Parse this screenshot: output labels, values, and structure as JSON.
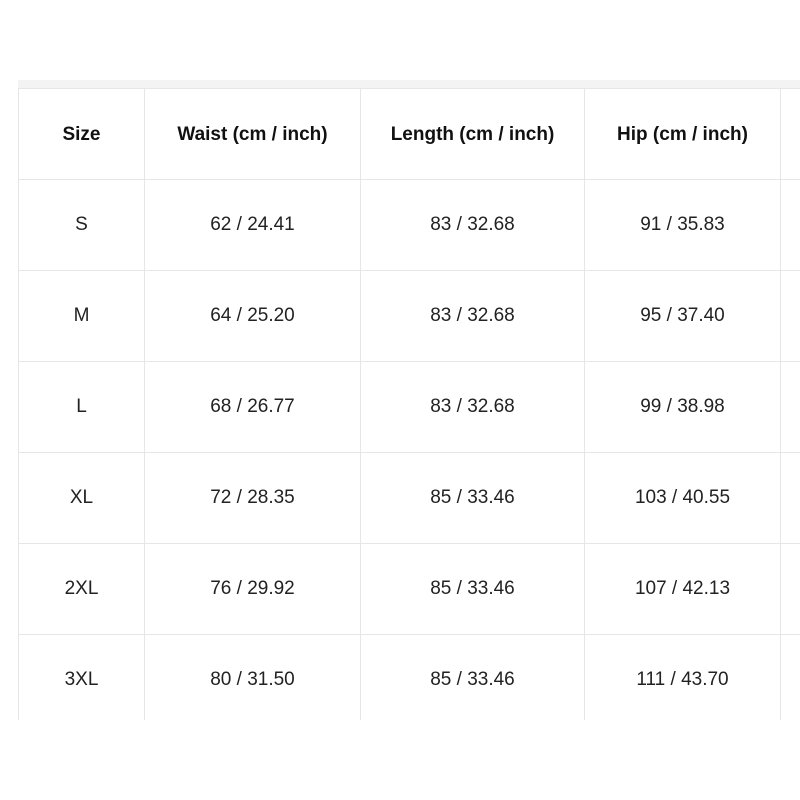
{
  "table": {
    "headers": [
      "Size",
      "Waist (cm / inch)",
      "Length (cm / inch)",
      "Hip (cm / inch)",
      ""
    ],
    "rows": [
      [
        "S",
        "62 / 24.41",
        "83 / 32.68",
        "91 / 35.83",
        ""
      ],
      [
        "M",
        "64 / 25.20",
        "83 / 32.68",
        "95 / 37.40",
        ""
      ],
      [
        "L",
        "68 / 26.77",
        "83 / 32.68",
        "99 / 38.98",
        ""
      ],
      [
        "XL",
        "72 / 28.35",
        "85 / 33.46",
        "103 / 40.55",
        ""
      ],
      [
        "2XL",
        "76 / 29.92",
        "85 / 33.46",
        "107 / 42.13",
        ""
      ],
      [
        "3XL",
        "80 / 31.50",
        "85 / 33.46",
        "111 / 43.70",
        ""
      ]
    ]
  },
  "colors": {
    "border": "#e6e6e6",
    "header_band": "#f3f3f3",
    "text": "#1a1a1a"
  }
}
